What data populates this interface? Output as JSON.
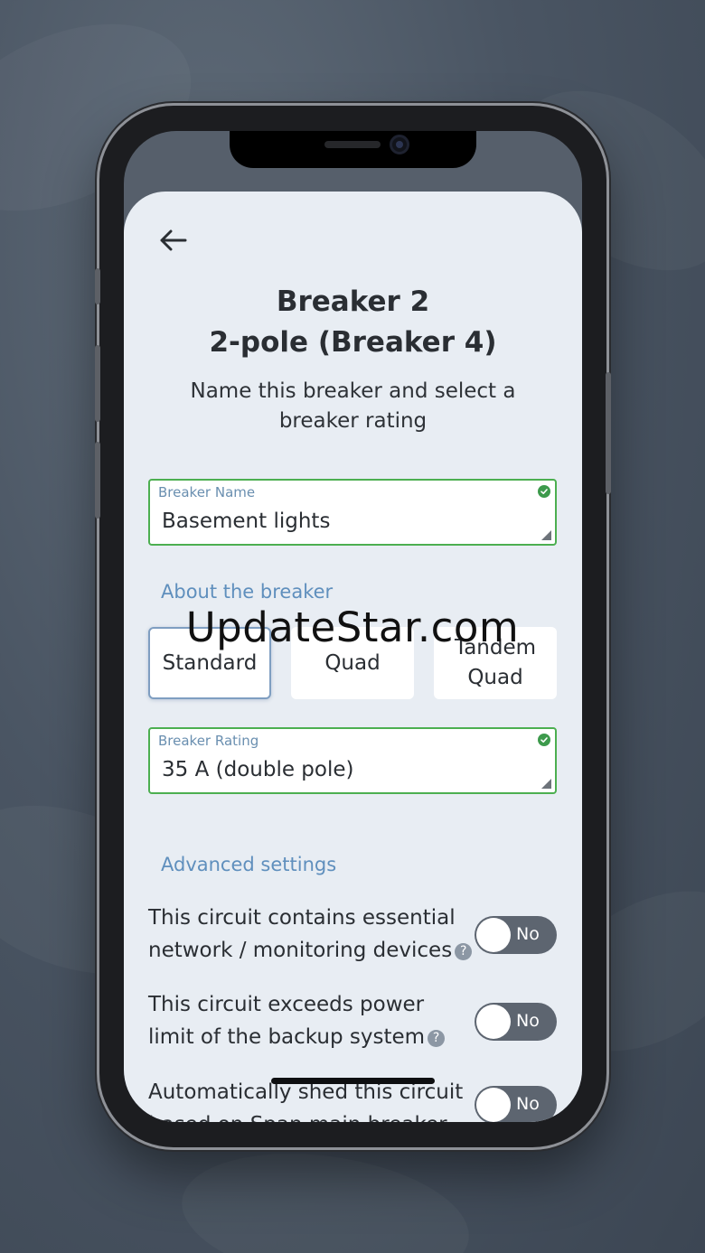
{
  "watermark": "UpdateStar.com",
  "header": {
    "title_line1": "Breaker 2",
    "title_line2": "2-pole (Breaker 4)",
    "subtitle": "Name this breaker and select a breaker rating"
  },
  "breaker_name_field": {
    "label": "Breaker Name",
    "value": "Basement lights"
  },
  "about_section": {
    "label": "About the breaker",
    "types": [
      {
        "label": "Standard",
        "selected": true
      },
      {
        "label": "Quad",
        "selected": false
      },
      {
        "label": "Tandem Quad",
        "selected": false
      }
    ]
  },
  "breaker_rating_field": {
    "label": "Breaker Rating",
    "value": "35 A (double pole)"
  },
  "advanced_section": {
    "label": "Advanced settings",
    "settings": [
      {
        "text": "This circuit contains essential network / monitoring devices",
        "help": "?",
        "toggle": "No"
      },
      {
        "text": "This circuit exceeds power limit of the backup system",
        "help": "?",
        "toggle": "No"
      },
      {
        "text": "Automatically shed this circuit based on Span main breaker",
        "toggle": "No"
      }
    ]
  },
  "colors": {
    "valid_border": "#4caf50",
    "accent_label": "#5f8fbd",
    "toggle_off": "#5d6570",
    "sheet_bg": "#e8edf3"
  },
  "icons": {
    "back": "arrow-left-icon",
    "valid": "check-circle-icon",
    "help": "question-circle-icon",
    "resize": "resize-handle-icon"
  }
}
